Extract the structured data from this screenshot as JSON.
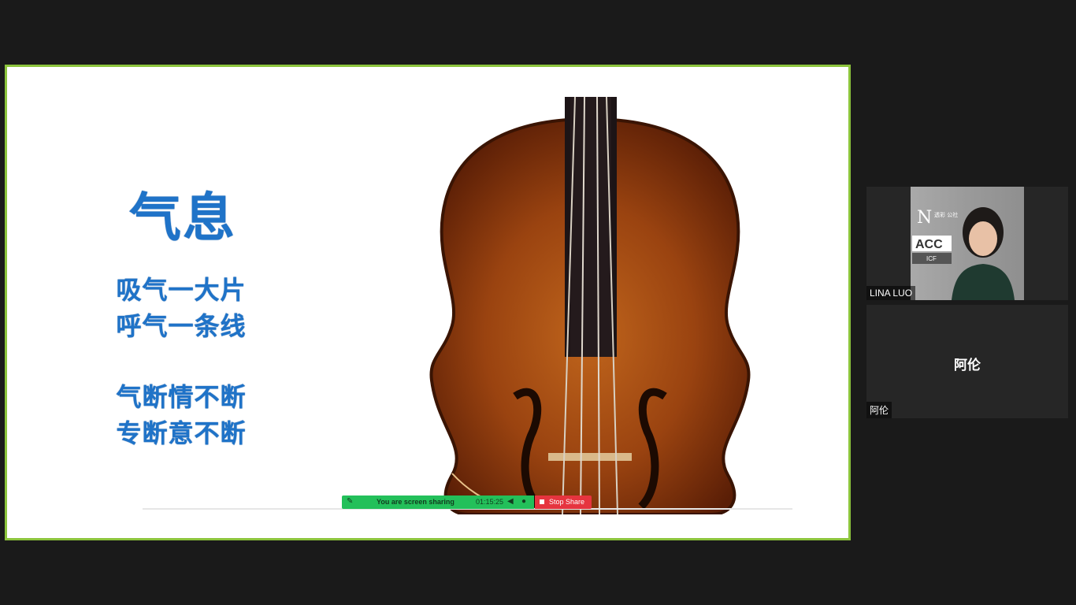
{
  "slide": {
    "title": "气息",
    "lines": [
      "吸气一大片",
      "呼气一条线",
      "气断情不断",
      "专断意不断"
    ]
  },
  "share_toolbar": {
    "status": "You are screen sharing",
    "timer": "01:15:25",
    "stop_label": "Stop Share",
    "bar_color": "#23c05a",
    "stop_color": "#e6343f"
  },
  "participants": [
    {
      "name": "LINA LUO",
      "logo_text": "ACC",
      "logo_sub": "ICF",
      "logo_chars": "透彩 公社"
    },
    {
      "name": "阿伦",
      "display": "阿伦"
    }
  ],
  "colors": {
    "frame_border": "#8cc43c",
    "slide_text": "#1f73c8"
  }
}
